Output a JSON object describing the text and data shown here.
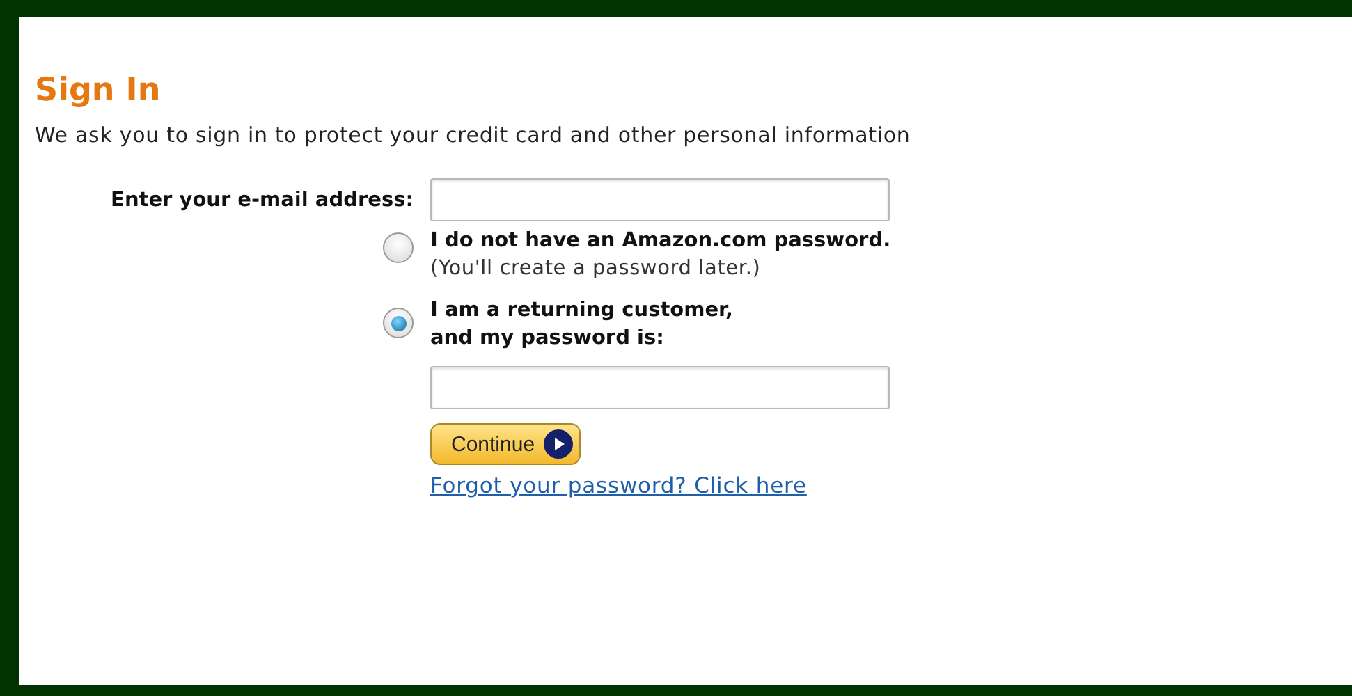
{
  "title": "Sign In",
  "intro": "We ask you to sign in to protect your credit card and other personal information",
  "email": {
    "label": "Enter your e-mail address:"
  },
  "options": [
    {
      "label": "I do not have an Amazon.com password.",
      "note": "(You'll create a password later.)",
      "selected": false
    },
    {
      "label": "I am a returning customer,\nand my password is:",
      "selected": true
    }
  ],
  "continue_button": "Continue",
  "forgot_link": "Forgot your password? Click here"
}
